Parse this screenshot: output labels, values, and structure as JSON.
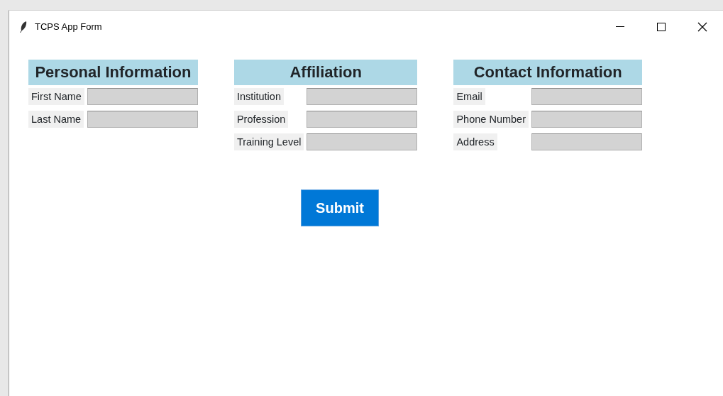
{
  "window": {
    "title": "TCPS App Form"
  },
  "sections": [
    {
      "title": "Personal Information",
      "fields": [
        {
          "label": "First Name"
        },
        {
          "label": "Last Name"
        }
      ]
    },
    {
      "title": "Affiliation",
      "fields": [
        {
          "label": "Institution"
        },
        {
          "label": "Profession"
        },
        {
          "label": "Training Level"
        }
      ]
    },
    {
      "title": "Contact Information",
      "fields": [
        {
          "label": "Email"
        },
        {
          "label": "Phone Number"
        },
        {
          "label": "Address"
        }
      ]
    }
  ],
  "submit": {
    "label": "Submit"
  }
}
